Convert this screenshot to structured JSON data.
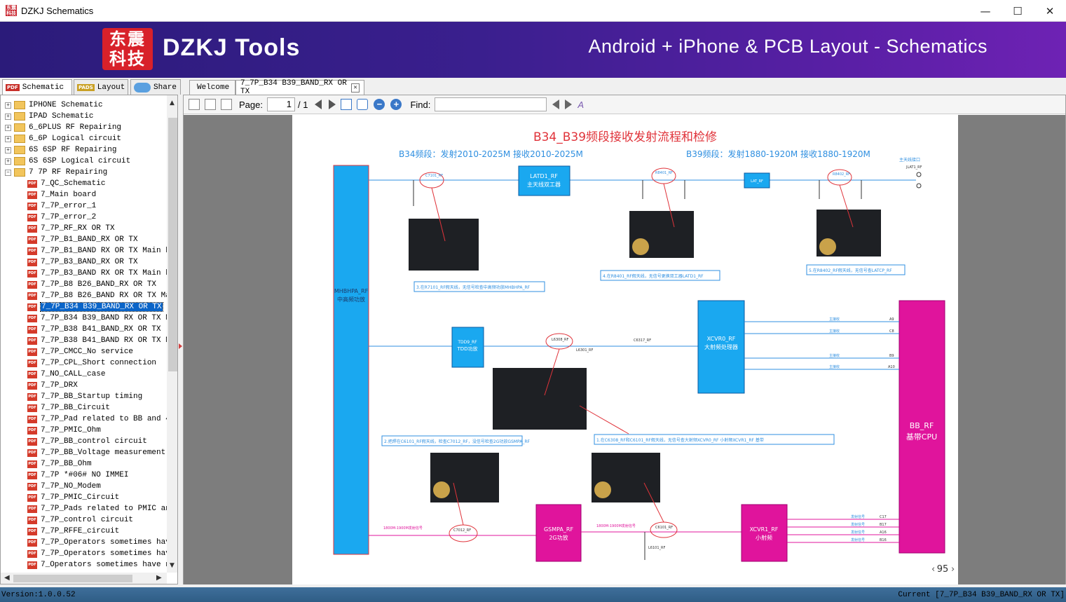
{
  "window": {
    "title": "DZKJ Schematics",
    "app_icon_text": "东震科技",
    "minimize": "—",
    "maximize": "☐",
    "close": "✕"
  },
  "banner": {
    "logo_text": "东震科技",
    "brand": "DZKJ Tools",
    "tagline": "Android + iPhone & PCB Layout - Schematics"
  },
  "tabs": [
    {
      "label": "Schematic",
      "badge": "PDF"
    },
    {
      "label": "Layout",
      "badge": "PADS"
    },
    {
      "label": "Share",
      "badge": ""
    }
  ],
  "doc_tabs": [
    {
      "label": "Welcome"
    },
    {
      "label": "7_7P_B34 B39_BAND_RX OR TX"
    }
  ],
  "tree": {
    "folders": [
      "IPHONE Schematic",
      "IPAD Schematic",
      "6_6PLUS RF Repairing",
      "6_6P Logical circuit",
      "6S 6SP RF Repairing",
      "6S 6SP Logical circuit",
      "7 7P RF Repairing"
    ],
    "items": [
      "7_QC_Schematic",
      "7_Main board",
      "7_7P_error_1",
      "7_7P_error_2",
      "7_7P_RF_RX OR TX",
      "7_7P_B1_BAND_RX OR TX",
      "7_7P_B1_BAND RX OR TX Main boa",
      "7_7P_B3_BAND_RX OR TX",
      "7_7P_B3_BAND RX OR TX Main boa",
      "7_7P_B8 B26_BAND_RX OR TX",
      "7_7P_B8 B26_BAND RX OR TX Main",
      "7_7P_B34 B39_BAND_RX OR TX",
      "7_7P_B34 B39_BAND RX OR TX Mai",
      "7_7P_B38 B41_BAND_RX OR TX",
      "7_7P_B38 B41_BAND RX OR TX Mai",
      "7_7P_CMCC_No service",
      "7_7P_CPL_Short connection",
      "7_NO_CALL_case",
      "7_7P_DRX",
      "7_7P_BB_Startup timing",
      "7_7P_BB_Circuit",
      "7_7P_Pad related to BB and 401",
      "7_7P_PMIC_Ohm",
      "7_7P_BB_control circuit",
      "7_7P_BB_Voltage measurement",
      "7_7P_BB_Ohm",
      "7_7P *#06# NO IMMEI",
      "7_7P_NO_Modem",
      "7_7P_PMIC_Circuit",
      "7_7P_Pads related to PMIC and",
      "7_7P_control circuit",
      "7_7P_RFFE_circuit",
      "7_7P_Operators sometimes have",
      "7_7P_Operators sometimes have",
      "7_Operators sometimes have no"
    ],
    "selected_index": 11
  },
  "toolbar": {
    "page_label": "Page:",
    "page_value": "1",
    "page_total": "/ 1",
    "find_label": "Find:"
  },
  "schematic": {
    "title": "B34_B39频段接收发射流程和检修",
    "b34_heading": "B34频段：发射2010-2025M  接收2010-2025M",
    "b39_heading": "B39频段：发射1880-1920M  接收1880-1920M",
    "blocks": {
      "mhbpa": "MHBHPA_RF\n中高频功放",
      "latd1": "LATD1_RF\n主天线双工器",
      "tdd": "TDD9_RF\nTDD功放",
      "xcvr0": "XCVR0_RF\n大射频处理器",
      "bb": "BB_RF\n基带CPU",
      "gsmpa": "GSMPA_RF\n2G功放",
      "xcvr1": "XCVR1_RF\n小射频",
      "antsw": "LAT_RF\n主天线开关"
    },
    "labels": {
      "main_ant": "主天线接口",
      "j_rf": "JLAT1_RF",
      "c7101": "C7101_RF",
      "r8401": "R8401_RF",
      "r8402": "R8402_RF",
      "l6308": "L6308_RF",
      "c7012": "C7012_RF",
      "c6101": "C6101_RF",
      "l6101": "L6101_RF",
      "c6317": "C6317_RF",
      "l6301": "L6301_RF",
      "note1": "3.在R7101_RF假天线，无信号检查中高频功放MHBHPA_RF",
      "note2": "4.在R8401_RF假天线，无信号更换双工器LATD1_RF",
      "note3": "5.在R8402_RF假天线，无信号查LATCP_RF",
      "note4": "2.把焊在C6101_RF假天线，检查C7012_RF，没信号检查2G功放GSMPA_RF",
      "note5": "1.在C6308_RF和C6101_RF假天线，无信号查大射频XCVR0_RF 小射频XCVR1_RF 基带",
      "tx_label": "1800M-1900M发射信号",
      "rx_main": "主接收",
      "tx_sig": "发射信号",
      "pins_bb": [
        "A9",
        "C8",
        "B9",
        "A10"
      ],
      "pins_x1": [
        "C17",
        "B17",
        "A16",
        "B16"
      ],
      "page_number": "95"
    }
  },
  "status": {
    "version": "Version:1.0.0.52",
    "current": "Current [7_7P_B34 B39_BAND_RX OR TX]"
  },
  "colors": {
    "banner_start": "#2b1b7a",
    "banner_end": "#6e22b4",
    "select": "#0a64c8",
    "schem_red": "#e0333a",
    "schem_blue": "#2f8fe0",
    "block_cyan": "#1aa8f0",
    "block_magenta": "#e0149c"
  }
}
